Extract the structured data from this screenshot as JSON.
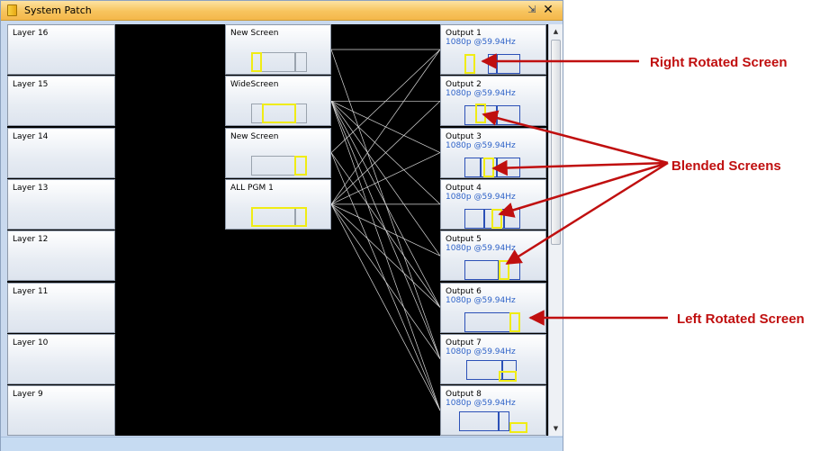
{
  "window": {
    "title": "System Patch",
    "pin_glyph": "⇲",
    "close_glyph": "✕"
  },
  "layers": [
    "Layer 16",
    "Layer 15",
    "Layer 14",
    "Layer 13",
    "Layer 12",
    "Layer 11",
    "Layer 10",
    "Layer 9"
  ],
  "screens": [
    {
      "label": "New Screen",
      "kind": "single-left"
    },
    {
      "label": "WideScreen",
      "kind": "double-center"
    },
    {
      "label": "New Screen",
      "kind": "single-right"
    },
    {
      "label": "ALL PGM 1",
      "kind": "full"
    }
  ],
  "outputs": [
    {
      "label": "Output 1",
      "resolution": "1080p @59.94Hz"
    },
    {
      "label": "Output 2",
      "resolution": "1080p @59.94Hz"
    },
    {
      "label": "Output 3",
      "resolution": "1080p @59.94Hz"
    },
    {
      "label": "Output 4",
      "resolution": "1080p @59.94Hz"
    },
    {
      "label": "Output 5",
      "resolution": "1080p @59.94Hz"
    },
    {
      "label": "Output 6",
      "resolution": "1080p @59.94Hz"
    },
    {
      "label": "Output 7",
      "resolution": "1080p @59.94Hz"
    },
    {
      "label": "Output 8",
      "resolution": "1080p @59.94Hz"
    }
  ],
  "annotations": {
    "right_rotated": "Right Rotated Screen",
    "blended": "Blended Screens",
    "left_rotated": "Left Rotated Screen"
  },
  "colors": {
    "annotation": "#c00f0f",
    "yellow_region": "#f0ec14",
    "output_frame": "#2c51b7",
    "resolution_text": "#2f63c8",
    "title_bar": "#f7c45e"
  }
}
